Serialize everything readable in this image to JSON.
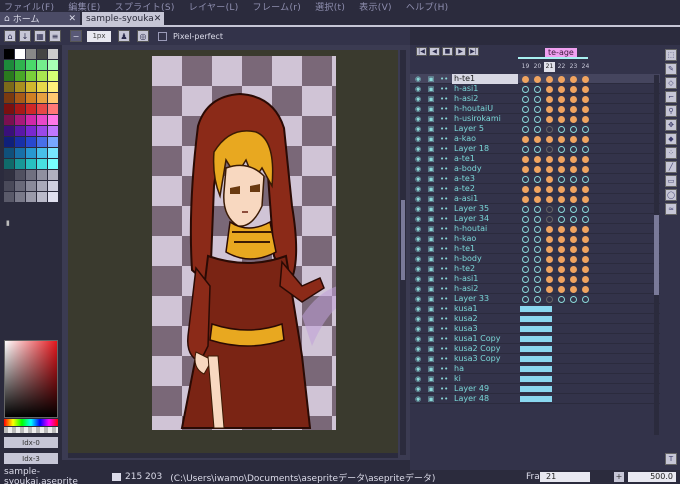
{
  "menu": [
    "ファイル(F)",
    "編集(E)",
    "スプライト(S)",
    "レイヤー(L)",
    "フレーム(r)",
    "選択(t)",
    "表示(V)",
    "ヘルプ(H)"
  ],
  "tabs": {
    "home": {
      "label": "ホーム"
    },
    "file": {
      "label": "sample-syouka"
    }
  },
  "context": {
    "brush_size": "1px",
    "pixel_perfect_label": "Pixel-perfect"
  },
  "palette": {
    "swatches": [
      "#000000",
      "#ffffff",
      "#888888",
      "#444444",
      "#cccccc",
      "#1d8a3a",
      "#2fb24e",
      "#4ad86a",
      "#74ee8d",
      "#a8ffb5",
      "#2a7a1e",
      "#49a828",
      "#7ad03a",
      "#a8e850",
      "#d6ff74",
      "#7a6a1a",
      "#a89020",
      "#d0b82e",
      "#e8d84a",
      "#fff07a",
      "#7a3a10",
      "#a85a18",
      "#d08024",
      "#e8a040",
      "#ffc870",
      "#7a1010",
      "#a81818",
      "#d02828",
      "#e84848",
      "#ff7878",
      "#7a1050",
      "#a8187a",
      "#d028a8",
      "#e848c8",
      "#ff78e8",
      "#3a107a",
      "#5a18a8",
      "#7a28d0",
      "#9a48e8",
      "#c078ff",
      "#10207a",
      "#1830a8",
      "#2848d0",
      "#4870e8",
      "#78a8ff",
      "#10507a",
      "#1870a8",
      "#2898d0",
      "#48c0e8",
      "#78e8ff",
      "#106a6a",
      "#189898",
      "#28c0c0",
      "#48e0e0",
      "#78ffff",
      "#303040",
      "#505060",
      "#707080",
      "#9090a0",
      "#b0b0c0",
      "#4a4a5a",
      "#6a6a7a",
      "#8a8a9a",
      "#aaaaba",
      "#d0d0e0",
      "#5a5a6a",
      "#7a7a8a",
      "#9a9aaa",
      "#babaca",
      "#e0e0f0"
    ],
    "fg_label": "Idx-0",
    "bg_label": "Idx-3"
  },
  "timeline": {
    "tag": "te-age",
    "frames": [
      "19",
      "20",
      "21",
      "22",
      "23",
      "24"
    ],
    "active_frame": "21",
    "layers": [
      {
        "name": "h-te1",
        "active": true,
        "cels": [
          "full",
          "full",
          "full",
          "full",
          "full",
          "full"
        ]
      },
      {
        "name": "h-asi1",
        "cels": [
          "empty",
          "empty",
          "full",
          "full",
          "full",
          "full"
        ]
      },
      {
        "name": "h-asi2",
        "cels": [
          "empty",
          "empty",
          "full",
          "full",
          "full",
          "full"
        ]
      },
      {
        "name": "h-houtaiU",
        "cels": [
          "empty",
          "empty",
          "full",
          "full",
          "full",
          "full"
        ]
      },
      {
        "name": "h-usirokami",
        "cels": [
          "empty",
          "empty",
          "full",
          "full",
          "full",
          "full"
        ]
      },
      {
        "name": "Layer 5",
        "cels": [
          "empty",
          "empty",
          "dim",
          "empty",
          "empty",
          "empty"
        ]
      },
      {
        "name": "a-kao",
        "cels": [
          "full",
          "full",
          "full",
          "full",
          "full",
          "full"
        ]
      },
      {
        "name": "Layer 18",
        "cels": [
          "empty",
          "empty",
          "dim",
          "empty",
          "empty",
          "empty"
        ]
      },
      {
        "name": "a-te1",
        "cels": [
          "full",
          "full",
          "full",
          "full",
          "full",
          "full"
        ]
      },
      {
        "name": "a-body",
        "cels": [
          "full",
          "full",
          "full",
          "full",
          "full",
          "full"
        ]
      },
      {
        "name": "a-te3",
        "cels": [
          "empty",
          "empty",
          "full",
          "empty",
          "empty",
          "empty"
        ]
      },
      {
        "name": "a-te2",
        "cels": [
          "full",
          "full",
          "full",
          "full",
          "full",
          "full"
        ]
      },
      {
        "name": "a-asi1",
        "cels": [
          "full",
          "full",
          "full",
          "full",
          "full",
          "full"
        ]
      },
      {
        "name": "Layer 35",
        "cels": [
          "empty",
          "empty",
          "dim",
          "empty",
          "empty",
          "empty"
        ]
      },
      {
        "name": "Layer 34",
        "cels": [
          "empty",
          "empty",
          "dim",
          "empty",
          "empty",
          "empty"
        ]
      },
      {
        "name": "h-houtai",
        "cels": [
          "empty",
          "empty",
          "full",
          "full",
          "full",
          "full"
        ]
      },
      {
        "name": "h-kao",
        "cels": [
          "empty",
          "empty",
          "full",
          "full",
          "full",
          "full"
        ]
      },
      {
        "name": "h-te1",
        "cels": [
          "empty",
          "empty",
          "full",
          "full",
          "full",
          "full"
        ]
      },
      {
        "name": "h-body",
        "cels": [
          "empty",
          "empty",
          "full",
          "full",
          "full",
          "full"
        ]
      },
      {
        "name": "h-te2",
        "cels": [
          "empty",
          "empty",
          "full",
          "full",
          "full",
          "full"
        ]
      },
      {
        "name": "h-asi1",
        "cels": [
          "empty",
          "empty",
          "full",
          "full",
          "full",
          "full"
        ]
      },
      {
        "name": "h-asi2",
        "cels": [
          "empty",
          "empty",
          "full",
          "full",
          "full",
          "full"
        ]
      },
      {
        "name": "Layer 33",
        "cels": [
          "empty",
          "empty",
          "dim",
          "empty",
          "empty",
          "empty"
        ]
      },
      {
        "name": "kusa1",
        "bar": true
      },
      {
        "name": "kusa2",
        "bar": true
      },
      {
        "name": "kusa3",
        "bar": true
      },
      {
        "name": "kusa1 Copy",
        "bar": true
      },
      {
        "name": "kusa2 Copy",
        "bar": true
      },
      {
        "name": "kusa3 Copy",
        "bar": true
      },
      {
        "name": "ha",
        "bar": true
      },
      {
        "name": "ki",
        "bar": true
      },
      {
        "name": "Layer 49",
        "bar": true
      },
      {
        "name": "Layer 48",
        "bar": true
      }
    ]
  },
  "status": {
    "file": "sample-syoukai.aseprite",
    "position": "215 203",
    "path": "(C:\\Users\\iwamo\\Documents\\asepriteデータ\\asepriteデータ)",
    "frame_label": "Frame:",
    "frame_value": "21",
    "zoom": "500.0"
  }
}
